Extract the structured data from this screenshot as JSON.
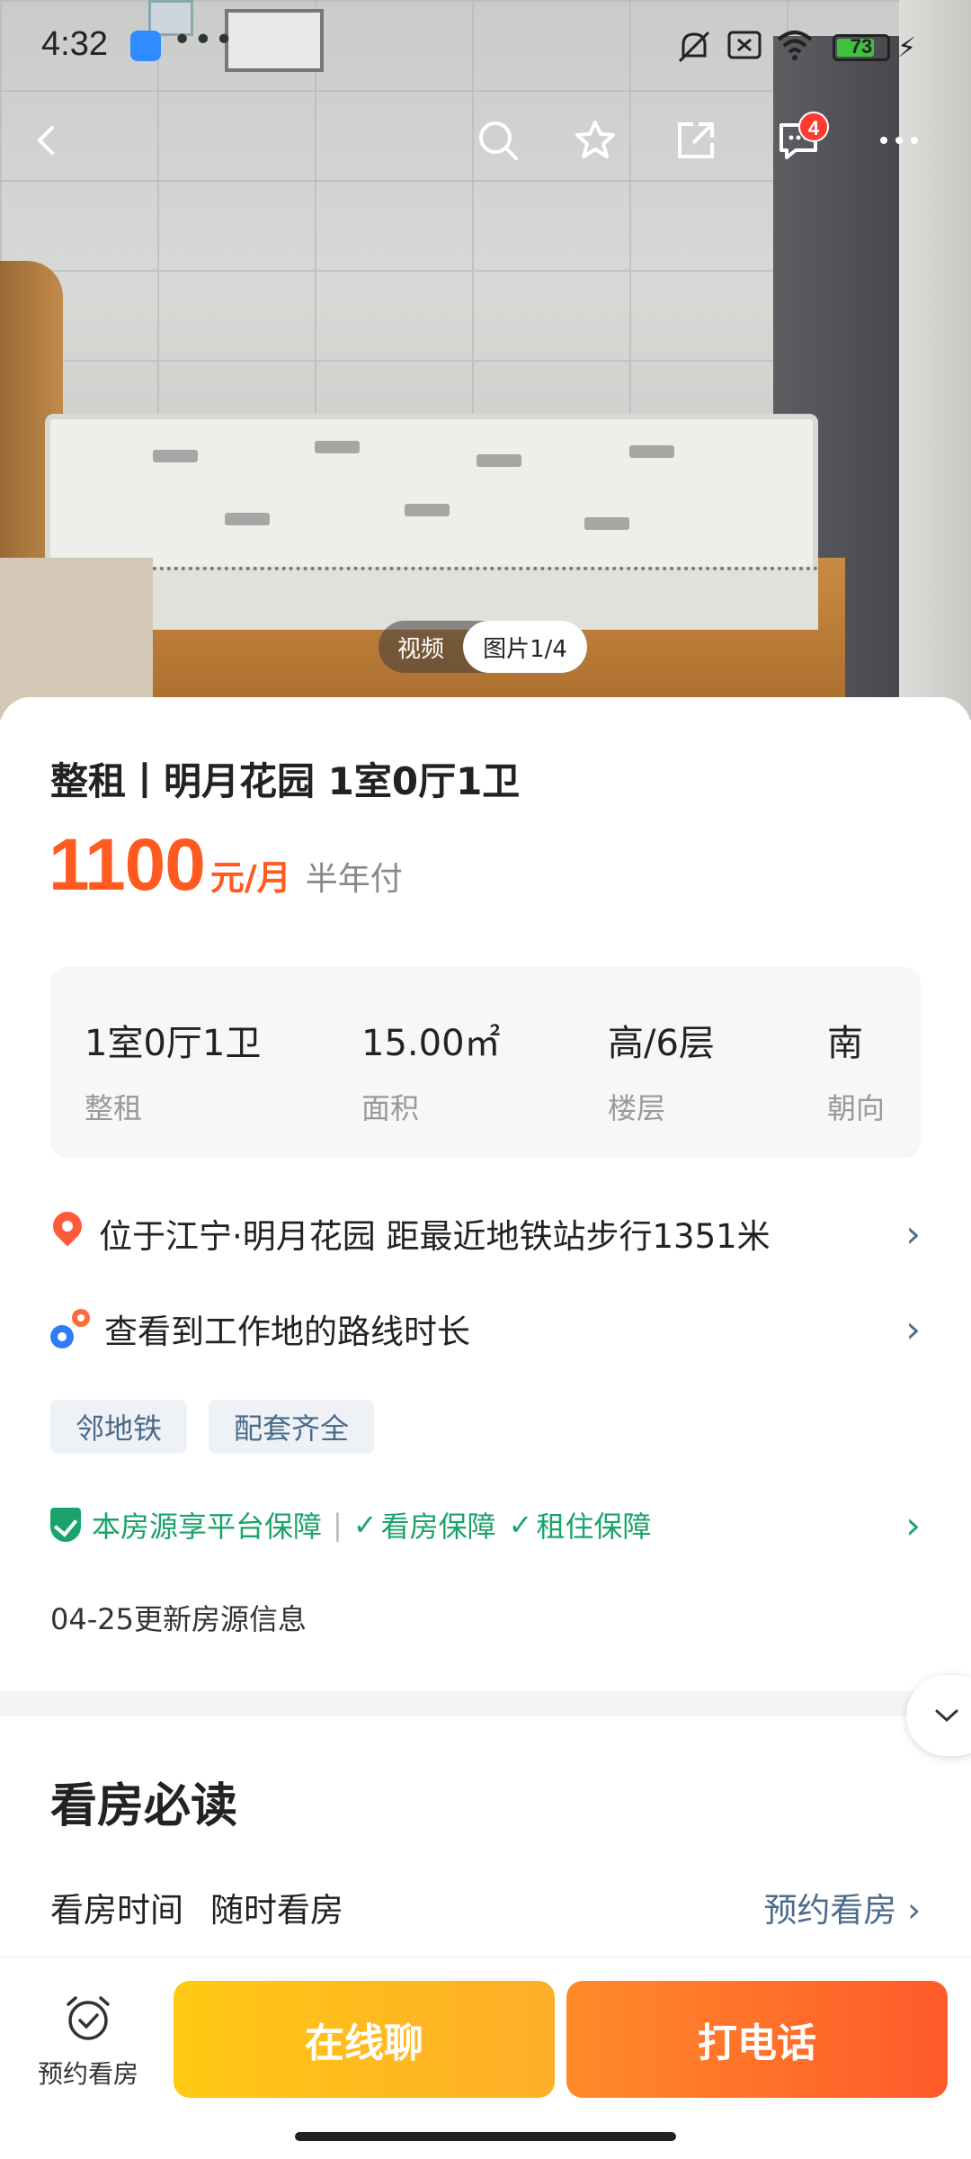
{
  "status_bar": {
    "time": "4:32",
    "more": "•••",
    "battery": "73",
    "battery_level": 0.73
  },
  "hero": {
    "media_video": "视频",
    "media_pictures": "图片1/4",
    "message_badge": "4"
  },
  "listing": {
    "title": "整租丨明月花园 1室0厅1卫",
    "price": "1100",
    "price_unit": "元/月",
    "payment": "半年付",
    "specs": [
      {
        "value": "1室0厅1卫",
        "label": "整租"
      },
      {
        "value": "15.00㎡",
        "label": "面积"
      },
      {
        "value": "高/6层",
        "label": "楼层"
      },
      {
        "value": "南",
        "label": "朝向"
      }
    ],
    "location": "位于江宁·明月花园 距最近地铁站步行1351米",
    "commute": "查看到工作地的路线时长",
    "tags": [
      "邻地铁",
      "配套齐全"
    ],
    "guarantee": {
      "main": "本房源享平台保障",
      "item1": "看房保障",
      "item2": "租住保障"
    },
    "update": "04-25更新房源信息"
  },
  "viewing": {
    "section_title": "看房必读",
    "time_label": "看房时间",
    "time_value": "随时看房",
    "action": "预约看房"
  },
  "bottom_bar": {
    "remind_label": "预约看房",
    "chat": "在线聊",
    "call": "打电话"
  },
  "colors": {
    "price": "#ff5a1f",
    "accent_link": "#4c6c8c",
    "guarantee": "#1aa36b",
    "chat_btn": "#ffc913",
    "call_btn": "#ff6a2a"
  }
}
